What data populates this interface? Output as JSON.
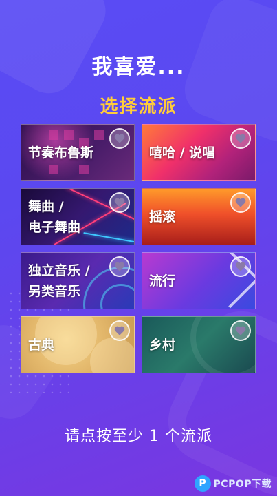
{
  "header": {
    "title": "我喜爱...",
    "subtitle": "选择流派"
  },
  "genres": [
    {
      "label": "节奏布鲁斯"
    },
    {
      "label": "嘻哈 / 说唱"
    },
    {
      "label": "舞曲 /\n电子舞曲"
    },
    {
      "label": "摇滚"
    },
    {
      "label": "独立音乐 /\n另类音乐"
    },
    {
      "label": "流行"
    },
    {
      "label": "古典"
    },
    {
      "label": "乡村"
    }
  ],
  "footer": {
    "hint": "请点按至少 1 个流派"
  },
  "watermark": {
    "logo": "P",
    "text": "PCPOP下载"
  },
  "colors": {
    "accent": "#ffcc3a",
    "background": "#5b48f0",
    "heart": "#8a7aa8"
  }
}
